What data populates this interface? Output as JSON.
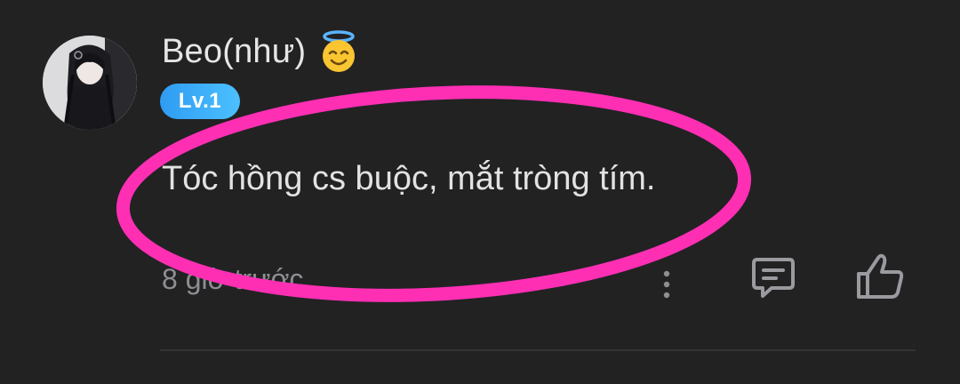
{
  "comment": {
    "username": "Beo(như)",
    "username_emoji": "smiling-face-with-halo-icon",
    "level": "Lv.1",
    "text": "Tóc hồng cs buộc, mắt tròng tím.",
    "timestamp": "8 giờ trước",
    "actions": {
      "more": "more-options-icon",
      "reply": "comment-reply-icon",
      "like": "thumbs-up-icon"
    }
  },
  "annotation": {
    "shape": "ellipse",
    "color": "#ff2fb4"
  },
  "colors": {
    "background": "#222223",
    "level_badge": "#3aaef7",
    "muted_text": "#8e8e93"
  }
}
